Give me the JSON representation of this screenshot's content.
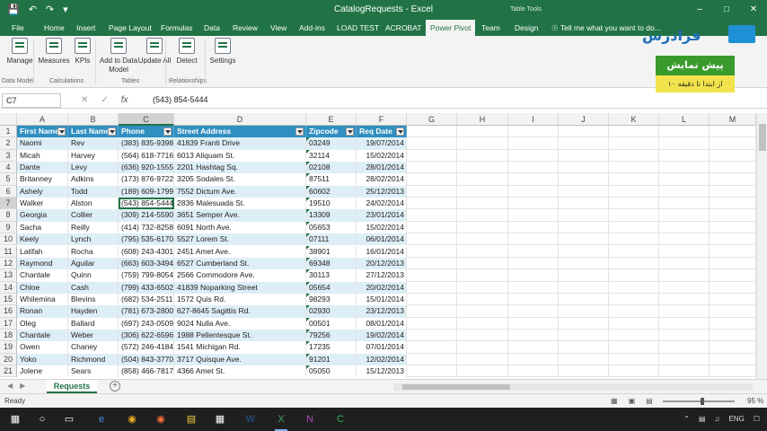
{
  "window": {
    "title": "CatalogRequests - Excel",
    "table_tools": "Table Tools",
    "controls": [
      "–",
      "□",
      "✕"
    ]
  },
  "tabs": [
    "File",
    "Home",
    "Insert",
    "Page Layout",
    "Formulas",
    "Data",
    "Review",
    "View",
    "Add-ins",
    "LOAD TEST",
    "ACROBAT",
    "Power Pivot",
    "Team",
    "Design"
  ],
  "active_tab": "Power Pivot",
  "tell_me": "Tell me what you want to do...",
  "share_label": "are",
  "ribbon": {
    "buttons": [
      {
        "label": "Manage"
      },
      {
        "label": "Measures"
      },
      {
        "label": "KPIs"
      },
      {
        "label": "Add to Data Model"
      },
      {
        "label": "Update All"
      },
      {
        "label": "Detect"
      },
      {
        "label": "Settings"
      }
    ],
    "groups": [
      "Data Model",
      "Calculations",
      "Tables",
      "Relationships"
    ]
  },
  "watermark": {
    "brand": "فرادرس",
    "banner_top": "پیش نمایش",
    "banner_bottom": "از ابتدا تا دقیقه ۱۰"
  },
  "formula_bar": {
    "name_box": "C7",
    "content": "(543) 854-5444"
  },
  "grid": {
    "columns": [
      "A",
      "B",
      "C",
      "D",
      "E",
      "F",
      "G",
      "H",
      "I",
      "J",
      "K",
      "L",
      "M"
    ],
    "selected_column": "C",
    "selected_row": 7,
    "table_headers": [
      "First Name",
      "Last Name",
      "Phone",
      "Street Address",
      "Zipcode",
      "Req Date"
    ],
    "rows": [
      [
        "Naomi",
        "Rev",
        "(383) 835-9398",
        "41839 Franti Drive",
        "03249",
        "19/07/2014"
      ],
      [
        "Micah",
        "Harvey",
        "(564) 618-7716",
        "6013 Aliquam St.",
        "32114",
        "15/02/2014"
      ],
      [
        "Dante",
        "Levy",
        "(636) 920-1555",
        "2201 Hashtag Sq.",
        "02108",
        "28/01/2014"
      ],
      [
        "Britanney",
        "Adkins",
        "(173) 876-9722",
        "3205 Sodales St.",
        "87511",
        "28/02/2014"
      ],
      [
        "Ashely",
        "Todd",
        "(189) 609-1799",
        "7552 Dictum Ave.",
        "60602",
        "25/12/2013"
      ],
      [
        "Walker",
        "Alston",
        "(543) 854-5444",
        "2836 Malesuada St.",
        "19510",
        "24/02/2014"
      ],
      [
        "Georgia",
        "Collier",
        "(309) 214-5590",
        "3651 Semper Ave.",
        "13309",
        "23/01/2014"
      ],
      [
        "Sacha",
        "Reilly",
        "(414) 732-8258",
        "6091 North Ave.",
        "05653",
        "15/02/2014"
      ],
      [
        "Keely",
        "Lynch",
        "(795) 535-6170",
        "5527 Lorem St.",
        "07111",
        "06/01/2014"
      ],
      [
        "Latifah",
        "Rocha",
        "(608) 243-4301",
        "2451 Amet Ave.",
        "38901",
        "16/01/2014"
      ],
      [
        "Raymond",
        "Aguilar",
        "(663) 603-3494",
        "6527 Cumberland St.",
        "69348",
        "20/12/2013"
      ],
      [
        "Chantale",
        "Quinn",
        "(759) 799-8054",
        "2566 Commodore Ave.",
        "30113",
        "27/12/2013"
      ],
      [
        "Chloe",
        "Cash",
        "(799) 433-6502",
        "41839 Noparking Street",
        "05654",
        "20/02/2014"
      ],
      [
        "Whilemina",
        "Blevins",
        "(682) 534-2511",
        "1572 Quis Rd.",
        "98293",
        "15/01/2014"
      ],
      [
        "Ronan",
        "Hayden",
        "(781) 673-2800",
        "627-8645 Sagittis Rd.",
        "02930",
        "23/12/2013"
      ],
      [
        "Oleg",
        "Ballard",
        "(697) 243-0509",
        "9024 Nulla Ave.",
        "00501",
        "08/01/2014"
      ],
      [
        "Chantale",
        "Weber",
        "(306) 622-6596",
        "1988 Pellentesque St.",
        "79256",
        "19/02/2014"
      ],
      [
        "Owen",
        "Chaney",
        "(572) 246-4184",
        "1541 Michigan Rd.",
        "17235",
        "07/01/2014"
      ],
      [
        "Yoko",
        "Richmond",
        "(504) 843-3770",
        "3717 Quisque Ave.",
        "91201",
        "12/02/2014"
      ],
      [
        "Jolene",
        "Sears",
        "(858) 466-7817",
        "4366 Amet St.",
        "05050",
        "15/12/2013"
      ]
    ]
  },
  "sheets": [
    "Requests"
  ],
  "status": {
    "ready": "Ready",
    "zoom": "95 %"
  },
  "taskbar": {
    "lang": "ENG"
  }
}
